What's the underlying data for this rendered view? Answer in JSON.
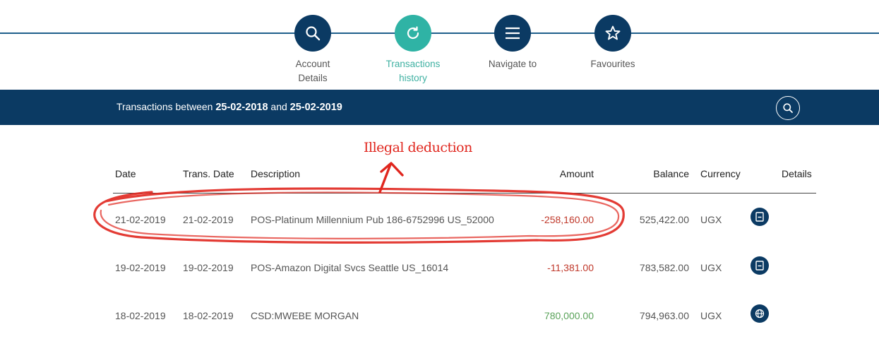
{
  "nav": {
    "items": [
      {
        "label": "Account\nDetails",
        "icon": "search-icon"
      },
      {
        "label": "Transactions\nhistory",
        "icon": "history-icon"
      },
      {
        "label": "Navigate to",
        "icon": "menu-icon"
      },
      {
        "label": "Favourites",
        "icon": "star-icon"
      }
    ]
  },
  "bar": {
    "prefix": "Transactions between",
    "start_date": "25-02-2018",
    "and": "and",
    "end_date": "25-02-2019"
  },
  "table": {
    "headers": {
      "date": "Date",
      "trans_date": "Trans. Date",
      "description": "Description",
      "amount": "Amount",
      "balance": "Balance",
      "currency": "Currency",
      "details": "Details"
    },
    "rows": [
      {
        "date": "21-02-2019",
        "trans_date": "21-02-2019",
        "description": "POS-Platinum Millennium Pub 186-6752996 US_52000",
        "amount": "-258,160.00",
        "balance": "525,422.00",
        "currency": "UGX"
      },
      {
        "date": "19-02-2019",
        "trans_date": "19-02-2019",
        "description": "POS-Amazon Digital Svcs Seattle US_16014",
        "amount": "-11,381.00",
        "balance": "783,582.00",
        "currency": "UGX"
      },
      {
        "date": "18-02-2019",
        "trans_date": "18-02-2019",
        "description": "CSD:MWEBE MORGAN",
        "amount": "780,000.00",
        "balance": "794,963.00",
        "currency": "UGX"
      }
    ]
  },
  "annotation": {
    "text": "Illegal deduction"
  },
  "colors": {
    "navy": "#0b3a63",
    "teal": "#2fb3a5",
    "negative": "#c0392b",
    "positive": "#5aa35a",
    "annotation": "#e0261e"
  }
}
